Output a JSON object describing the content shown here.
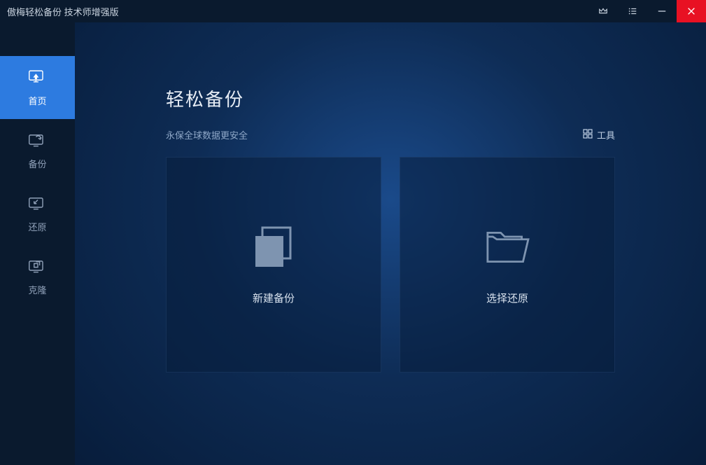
{
  "titlebar": {
    "title": "傲梅轻松备份 技术师增强版"
  },
  "sidebar": {
    "items": [
      {
        "label": "首页"
      },
      {
        "label": "备份"
      },
      {
        "label": "还原"
      },
      {
        "label": "克隆"
      }
    ]
  },
  "main": {
    "title": "轻松备份",
    "subtitle": "永保全球数据更安全",
    "tools_label": "工具",
    "cards": [
      {
        "label": "新建备份"
      },
      {
        "label": "选择还原"
      }
    ]
  }
}
